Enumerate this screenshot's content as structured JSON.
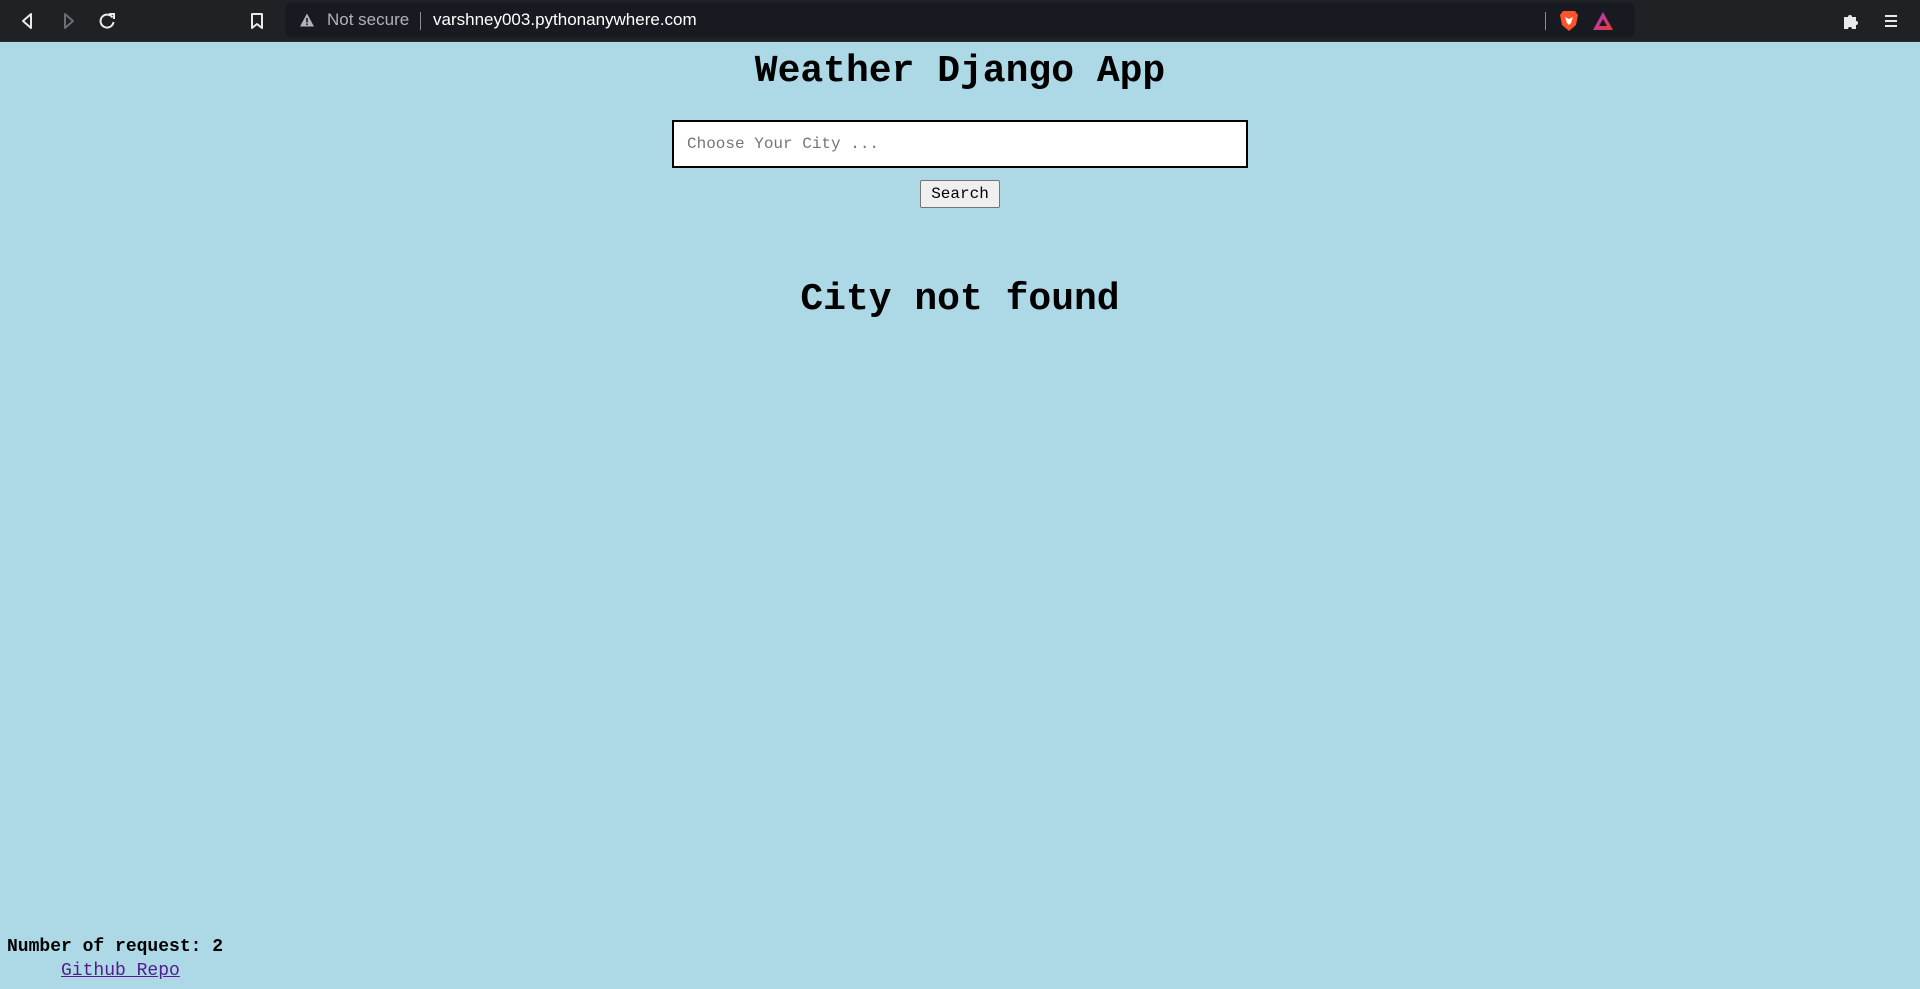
{
  "browser": {
    "address_warning": "Not secure",
    "url": "varshney003.pythonanywhere.com"
  },
  "app": {
    "title": "Weather Django App",
    "search": {
      "placeholder": "Choose Your City ...",
      "value": "",
      "button_label": "Search"
    },
    "result_message": "City not found",
    "footer": {
      "request_count_label": "Number of request: 2",
      "github_link": "Github Repo"
    }
  },
  "colors": {
    "page_background": "#add8e6",
    "chrome_background": "#202124",
    "visited_link": "#551a8b"
  }
}
